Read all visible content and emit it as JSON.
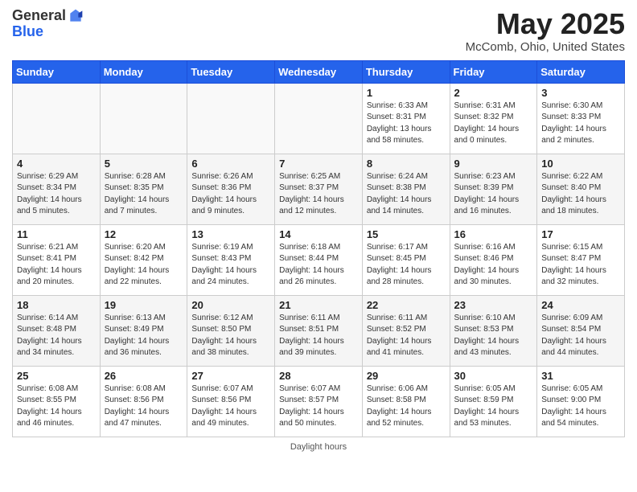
{
  "logo": {
    "general": "General",
    "blue": "Blue"
  },
  "title": "May 2025",
  "location": "McComb, Ohio, United States",
  "days_of_week": [
    "Sunday",
    "Monday",
    "Tuesday",
    "Wednesday",
    "Thursday",
    "Friday",
    "Saturday"
  ],
  "footer": "Daylight hours",
  "weeks": [
    [
      {
        "day": "",
        "sunrise": "",
        "sunset": "",
        "daylight": ""
      },
      {
        "day": "",
        "sunrise": "",
        "sunset": "",
        "daylight": ""
      },
      {
        "day": "",
        "sunrise": "",
        "sunset": "",
        "daylight": ""
      },
      {
        "day": "",
        "sunrise": "",
        "sunset": "",
        "daylight": ""
      },
      {
        "day": "1",
        "sunrise": "Sunrise: 6:33 AM",
        "sunset": "Sunset: 8:31 PM",
        "daylight": "Daylight: 13 hours and 58 minutes."
      },
      {
        "day": "2",
        "sunrise": "Sunrise: 6:31 AM",
        "sunset": "Sunset: 8:32 PM",
        "daylight": "Daylight: 14 hours and 0 minutes."
      },
      {
        "day": "3",
        "sunrise": "Sunrise: 6:30 AM",
        "sunset": "Sunset: 8:33 PM",
        "daylight": "Daylight: 14 hours and 2 minutes."
      }
    ],
    [
      {
        "day": "4",
        "sunrise": "Sunrise: 6:29 AM",
        "sunset": "Sunset: 8:34 PM",
        "daylight": "Daylight: 14 hours and 5 minutes."
      },
      {
        "day": "5",
        "sunrise": "Sunrise: 6:28 AM",
        "sunset": "Sunset: 8:35 PM",
        "daylight": "Daylight: 14 hours and 7 minutes."
      },
      {
        "day": "6",
        "sunrise": "Sunrise: 6:26 AM",
        "sunset": "Sunset: 8:36 PM",
        "daylight": "Daylight: 14 hours and 9 minutes."
      },
      {
        "day": "7",
        "sunrise": "Sunrise: 6:25 AM",
        "sunset": "Sunset: 8:37 PM",
        "daylight": "Daylight: 14 hours and 12 minutes."
      },
      {
        "day": "8",
        "sunrise": "Sunrise: 6:24 AM",
        "sunset": "Sunset: 8:38 PM",
        "daylight": "Daylight: 14 hours and 14 minutes."
      },
      {
        "day": "9",
        "sunrise": "Sunrise: 6:23 AM",
        "sunset": "Sunset: 8:39 PM",
        "daylight": "Daylight: 14 hours and 16 minutes."
      },
      {
        "day": "10",
        "sunrise": "Sunrise: 6:22 AM",
        "sunset": "Sunset: 8:40 PM",
        "daylight": "Daylight: 14 hours and 18 minutes."
      }
    ],
    [
      {
        "day": "11",
        "sunrise": "Sunrise: 6:21 AM",
        "sunset": "Sunset: 8:41 PM",
        "daylight": "Daylight: 14 hours and 20 minutes."
      },
      {
        "day": "12",
        "sunrise": "Sunrise: 6:20 AM",
        "sunset": "Sunset: 8:42 PM",
        "daylight": "Daylight: 14 hours and 22 minutes."
      },
      {
        "day": "13",
        "sunrise": "Sunrise: 6:19 AM",
        "sunset": "Sunset: 8:43 PM",
        "daylight": "Daylight: 14 hours and 24 minutes."
      },
      {
        "day": "14",
        "sunrise": "Sunrise: 6:18 AM",
        "sunset": "Sunset: 8:44 PM",
        "daylight": "Daylight: 14 hours and 26 minutes."
      },
      {
        "day": "15",
        "sunrise": "Sunrise: 6:17 AM",
        "sunset": "Sunset: 8:45 PM",
        "daylight": "Daylight: 14 hours and 28 minutes."
      },
      {
        "day": "16",
        "sunrise": "Sunrise: 6:16 AM",
        "sunset": "Sunset: 8:46 PM",
        "daylight": "Daylight: 14 hours and 30 minutes."
      },
      {
        "day": "17",
        "sunrise": "Sunrise: 6:15 AM",
        "sunset": "Sunset: 8:47 PM",
        "daylight": "Daylight: 14 hours and 32 minutes."
      }
    ],
    [
      {
        "day": "18",
        "sunrise": "Sunrise: 6:14 AM",
        "sunset": "Sunset: 8:48 PM",
        "daylight": "Daylight: 14 hours and 34 minutes."
      },
      {
        "day": "19",
        "sunrise": "Sunrise: 6:13 AM",
        "sunset": "Sunset: 8:49 PM",
        "daylight": "Daylight: 14 hours and 36 minutes."
      },
      {
        "day": "20",
        "sunrise": "Sunrise: 6:12 AM",
        "sunset": "Sunset: 8:50 PM",
        "daylight": "Daylight: 14 hours and 38 minutes."
      },
      {
        "day": "21",
        "sunrise": "Sunrise: 6:11 AM",
        "sunset": "Sunset: 8:51 PM",
        "daylight": "Daylight: 14 hours and 39 minutes."
      },
      {
        "day": "22",
        "sunrise": "Sunrise: 6:11 AM",
        "sunset": "Sunset: 8:52 PM",
        "daylight": "Daylight: 14 hours and 41 minutes."
      },
      {
        "day": "23",
        "sunrise": "Sunrise: 6:10 AM",
        "sunset": "Sunset: 8:53 PM",
        "daylight": "Daylight: 14 hours and 43 minutes."
      },
      {
        "day": "24",
        "sunrise": "Sunrise: 6:09 AM",
        "sunset": "Sunset: 8:54 PM",
        "daylight": "Daylight: 14 hours and 44 minutes."
      }
    ],
    [
      {
        "day": "25",
        "sunrise": "Sunrise: 6:08 AM",
        "sunset": "Sunset: 8:55 PM",
        "daylight": "Daylight: 14 hours and 46 minutes."
      },
      {
        "day": "26",
        "sunrise": "Sunrise: 6:08 AM",
        "sunset": "Sunset: 8:56 PM",
        "daylight": "Daylight: 14 hours and 47 minutes."
      },
      {
        "day": "27",
        "sunrise": "Sunrise: 6:07 AM",
        "sunset": "Sunset: 8:56 PM",
        "daylight": "Daylight: 14 hours and 49 minutes."
      },
      {
        "day": "28",
        "sunrise": "Sunrise: 6:07 AM",
        "sunset": "Sunset: 8:57 PM",
        "daylight": "Daylight: 14 hours and 50 minutes."
      },
      {
        "day": "29",
        "sunrise": "Sunrise: 6:06 AM",
        "sunset": "Sunset: 8:58 PM",
        "daylight": "Daylight: 14 hours and 52 minutes."
      },
      {
        "day": "30",
        "sunrise": "Sunrise: 6:05 AM",
        "sunset": "Sunset: 8:59 PM",
        "daylight": "Daylight: 14 hours and 53 minutes."
      },
      {
        "day": "31",
        "sunrise": "Sunrise: 6:05 AM",
        "sunset": "Sunset: 9:00 PM",
        "daylight": "Daylight: 14 hours and 54 minutes."
      }
    ]
  ]
}
